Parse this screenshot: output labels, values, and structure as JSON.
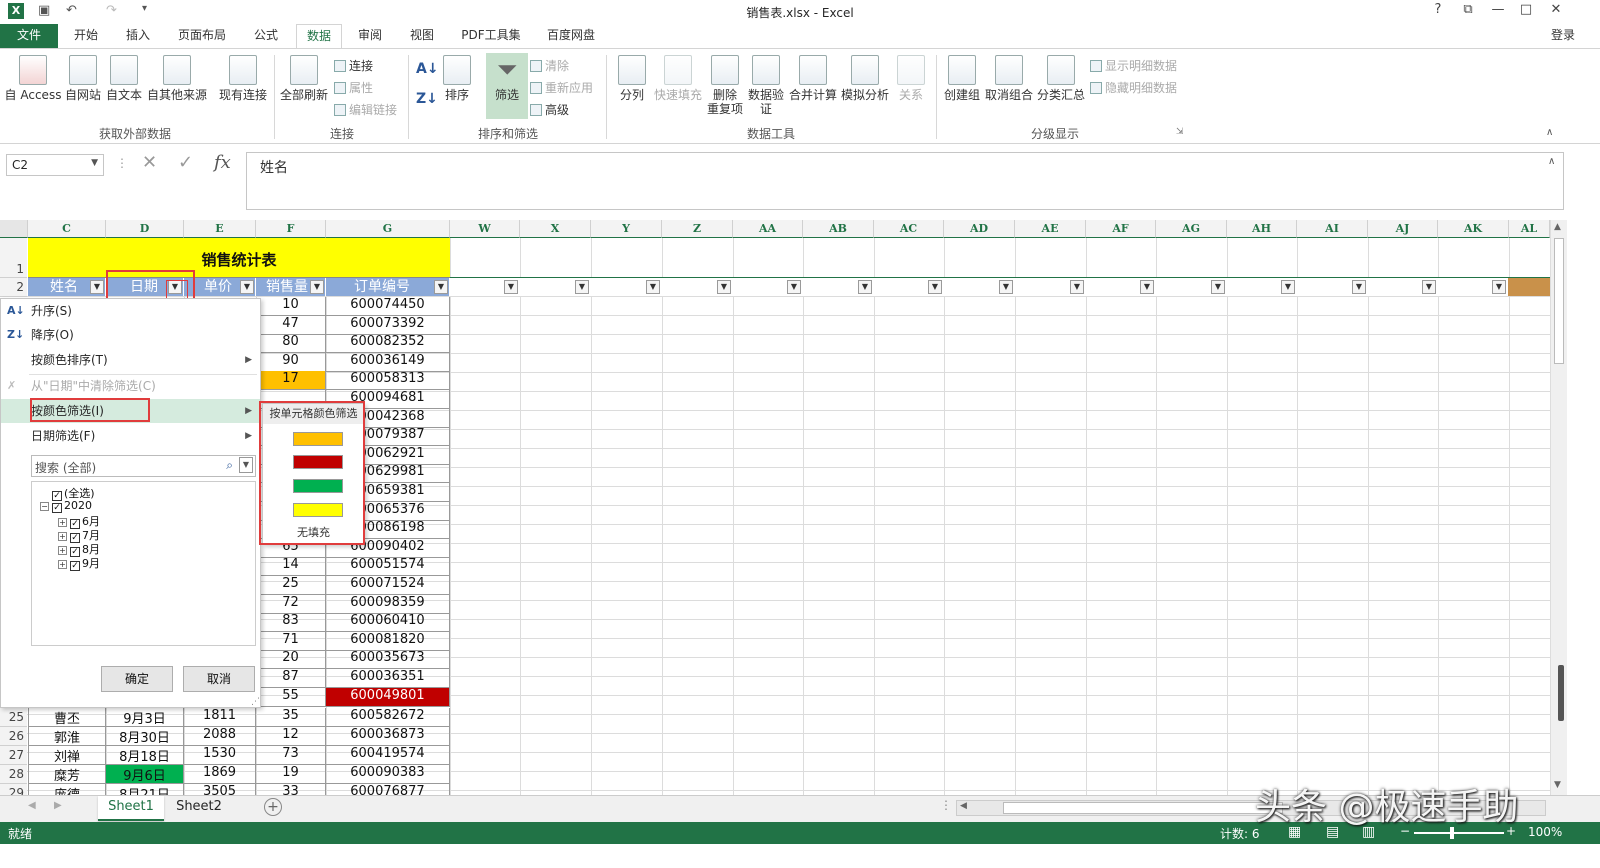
{
  "window": {
    "title": "销售表.xlsx - Excel",
    "help": "?",
    "minimize": "—",
    "restore": "□",
    "close": "✕",
    "login": "登录"
  },
  "tabs": [
    "文件",
    "开始",
    "插入",
    "页面布局",
    "公式",
    "数据",
    "审阅",
    "视图",
    "PDF工具集",
    "百度网盘"
  ],
  "ribbon": {
    "get_external": {
      "access": "自 Access",
      "web": "自网站",
      "text": "自文本",
      "other": "自其他来源",
      "existing": "现有连接",
      "group": "获取外部数据"
    },
    "connections": {
      "refresh_all": "全部刷新",
      "conn": "连接",
      "props": "属性",
      "edit_links": "编辑链接",
      "group": "连接"
    },
    "sort_filter": {
      "sort": "排序",
      "filter": "筛选",
      "clear": "清除",
      "reapply": "重新应用",
      "advanced": "高级",
      "group": "排序和筛选"
    },
    "data_tools": {
      "split": "分列",
      "flash": "快速填充",
      "dedup1": "删除",
      "dedup2": "重复项",
      "validate1": "数据验",
      "validate2": "证",
      "consolidate": "合并计算",
      "whatif": "模拟分析",
      "relations": "关系",
      "group": "数据工具"
    },
    "outline": {
      "group_btn": "创建组",
      "ungroup": "取消组合",
      "subtotal": "分类汇总",
      "show": "显示明细数据",
      "hide": "隐藏明细数据",
      "group": "分级显示"
    }
  },
  "formula_bar": {
    "namebox": "C2",
    "fx": "fx",
    "content": "姓名"
  },
  "columns_left": [
    "C",
    "D",
    "E",
    "F",
    "G"
  ],
  "columns_right": [
    "W",
    "X",
    "Y",
    "Z",
    "AA",
    "AB",
    "AC",
    "AD",
    "AE",
    "AF",
    "AG",
    "AH",
    "AI",
    "AJ",
    "AK",
    "AL"
  ],
  "sheet_title": "销售统计表",
  "headers": [
    "姓名",
    "日期",
    "单价",
    "销售量",
    "订单编号"
  ],
  "visible_rows_right": [
    {
      "f": "10",
      "g": "600074450"
    },
    {
      "f": "47",
      "g": "600073392"
    },
    {
      "f": "80",
      "g": "600082352"
    },
    {
      "f": "90",
      "g": "600036149"
    },
    {
      "f": "17",
      "g": "600058313"
    },
    {
      "f": "",
      "g": "600094681"
    },
    {
      "f": "",
      "g": "600042368"
    },
    {
      "f": "",
      "g": "600079387"
    },
    {
      "f": "",
      "g": "600062921"
    },
    {
      "f": "",
      "g": "600629981"
    },
    {
      "f": "",
      "g": "600659381"
    },
    {
      "f": "",
      "g": "600065376"
    },
    {
      "f": "",
      "g": "600086198"
    },
    {
      "f": "65",
      "g": "600090402"
    },
    {
      "f": "14",
      "g": "600051574"
    },
    {
      "f": "25",
      "g": "600071524"
    },
    {
      "f": "72",
      "g": "600098359"
    },
    {
      "f": "83",
      "g": "600060410"
    },
    {
      "f": "71",
      "g": "600081820"
    },
    {
      "f": "20",
      "g": "600035673"
    },
    {
      "f": "87",
      "g": "600036351"
    },
    {
      "f": "55",
      "g": "600049801"
    }
  ],
  "full_rows": [
    {
      "row": "25",
      "c": "曹丕",
      "d": "9月3日",
      "e": "1811",
      "f": "35",
      "g": "600582672"
    },
    {
      "row": "26",
      "c": "郭淮",
      "d": "8月30日",
      "e": "2088",
      "f": "12",
      "g": "600036873"
    },
    {
      "row": "27",
      "c": "刘禅",
      "d": "8月18日",
      "e": "1530",
      "f": "73",
      "g": "600419574"
    },
    {
      "row": "28",
      "c": "糜芳",
      "d": "9月6日",
      "e": "1869",
      "f": "19",
      "g": "600090383"
    },
    {
      "row": "29",
      "c": "庞德",
      "d": "8月21日",
      "e": "3505",
      "f": "33",
      "g": "600076877"
    }
  ],
  "row_labels": {
    "r1": "1",
    "r2": "2"
  },
  "filter_menu": {
    "sort_asc": "升序(S)",
    "sort_desc": "降序(O)",
    "sort_color": "按颜色排序(T)",
    "clear": "从\"日期\"中清除筛选(C)",
    "filter_color": "按颜色筛选(I)",
    "date_filter": "日期筛选(F)",
    "search_placeholder": "搜索 (全部)",
    "tree": [
      "(全选)",
      "2020",
      "6月",
      "7月",
      "8月",
      "9月"
    ],
    "ok": "确定",
    "cancel": "取消"
  },
  "color_menu": {
    "title": "按单元格颜色筛选",
    "no_fill": "无填充",
    "colors": [
      "#ffc000",
      "#c00000",
      "#00b050",
      "#ffff00"
    ]
  },
  "sheets": [
    "Sheet1",
    "Sheet2"
  ],
  "status": {
    "ready": "就绪",
    "count": "计数: 6",
    "zoom": "100%"
  },
  "watermark": "头条 @极速手助",
  "accent": "#217346"
}
